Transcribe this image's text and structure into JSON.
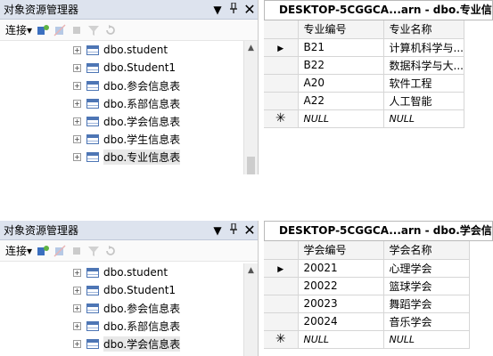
{
  "shots": [
    {
      "explorer": {
        "title": "对象资源管理器",
        "pin": "▾ 📌",
        "connect_label": "连接▾",
        "items": [
          "dbo.student",
          "dbo.Student1",
          "dbo.参会信息表",
          "dbo.系部信息表",
          "dbo.学会信息表",
          "dbo.学生信息表",
          "dbo.专业信息表"
        ],
        "selected": "dbo.专业信息表"
      },
      "result": {
        "tab": "DESKTOP-5CGGCA...arn - dbo.专业信息表",
        "columns": [
          "专业编号",
          "专业名称"
        ],
        "rows": [
          [
            "B21",
            "计算机科学与..."
          ],
          [
            "B22",
            "数据科学与大..."
          ],
          [
            "A20",
            "软件工程"
          ],
          [
            "A22",
            "人工智能"
          ]
        ],
        "new_row": [
          "NULL",
          "NULL"
        ]
      }
    },
    {
      "explorer": {
        "title": "对象资源管理器",
        "connect_label": "连接▾",
        "items": [
          "dbo.student",
          "dbo.Student1",
          "dbo.参会信息表",
          "dbo.系部信息表",
          "dbo.学会信息表"
        ],
        "selected": "dbo.学会信息表"
      },
      "result": {
        "tab": "DESKTOP-5CGGCA...arn - dbo.学会信息表",
        "columns": [
          "学会编号",
          "学会名称"
        ],
        "rows": [
          [
            "20021",
            "心理学会"
          ],
          [
            "20022",
            "篮球学会"
          ],
          [
            "20023",
            "舞蹈学会"
          ],
          [
            "20024",
            "音乐学会"
          ]
        ],
        "new_row": [
          "NULL",
          "NULL"
        ]
      }
    }
  ]
}
